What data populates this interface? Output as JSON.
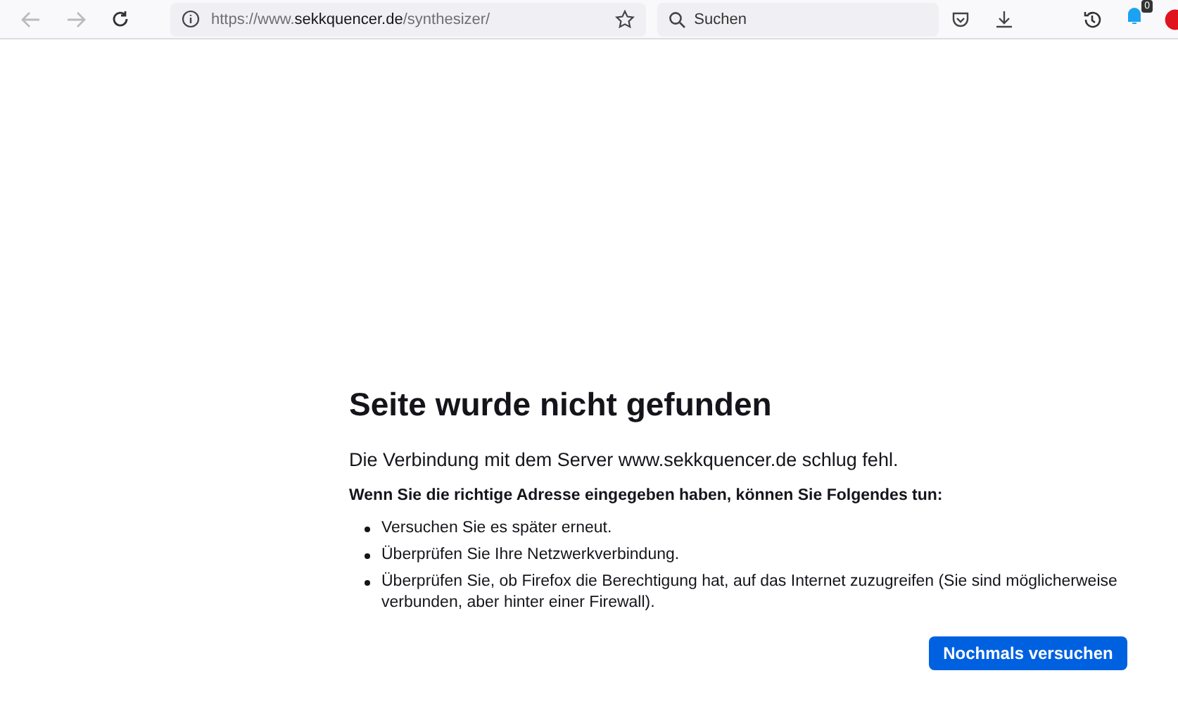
{
  "toolbar": {
    "back_disabled": true,
    "forward_disabled": true,
    "url": "https://www.**sekkquencer.de**/synthesizer/",
    "search": {
      "placeholder": "Suchen"
    },
    "notification_badge": "0"
  },
  "error": {
    "title": "Seite wurde nicht gefunden",
    "message": "Die Verbindung mit dem Server www.sekkquencer.de schlug fehl.",
    "hint": "Wenn Sie die richtige Adresse eingegeben haben, können Sie Folgendes tun:",
    "suggestions": [
      "Versuchen Sie es später erneut.",
      "Überprüfen Sie Ihre Netzwerkverbindung.",
      "Überprüfen Sie, ob Firefox die Berechtigung hat, auf das Internet zuzugreifen (Sie sind möglicherweise verbunden, aber hinter einer Firewall)."
    ],
    "button": "Nochmals versuchen"
  }
}
